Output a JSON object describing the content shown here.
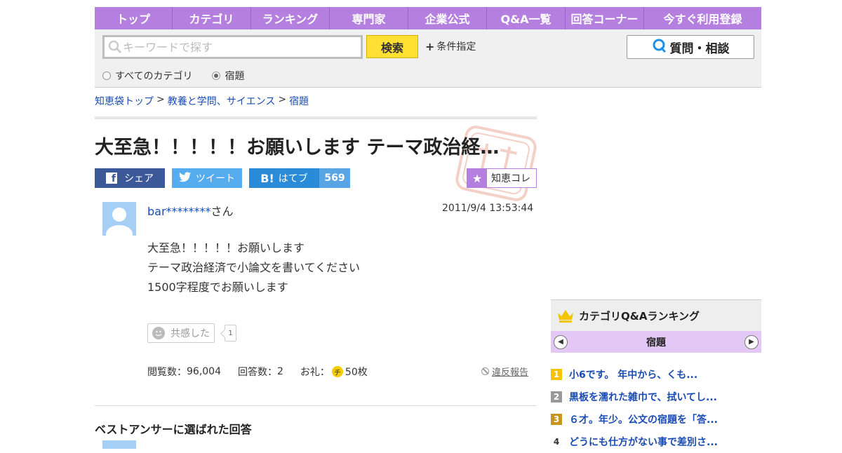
{
  "nav": {
    "items": [
      "トップ",
      "カテゴリ",
      "ランキング",
      "専門家",
      "企業公式",
      "Q&A一覧",
      "回答コーナー",
      "今すぐ利用登録"
    ]
  },
  "search": {
    "placeholder": "キーワードで探す",
    "button": "検索",
    "condition": "条件指定",
    "ask_button": "質問・相談",
    "radio_all": "すべてのカテゴリ",
    "radio_current": "宿題",
    "selected": "宿題"
  },
  "breadcrumb": {
    "items": [
      "知恵袋トップ",
      "教養と学問、サイエンス",
      "宿題"
    ],
    "separator": ">"
  },
  "question": {
    "title": "大至急！！！！！お願いします テーマ政治経…",
    "user": "bar********",
    "user_suffix": "さん",
    "date": "2011/9/4  13:53:44",
    "body": [
      "大至急！！！！！お願いします",
      "テーマ政治経済で小論文を書いてください",
      "1500字程度でお願いします"
    ],
    "empathy_label": "共感した",
    "empathy_count": "1",
    "views_label": "閲覧数：",
    "views": "96,004",
    "answers_label": "回答数：",
    "answers": "2",
    "reward_label": "お礼：",
    "reward_coin": "チ",
    "reward": "50枚",
    "report": "違反報告"
  },
  "share": {
    "facebook": "シェア",
    "twitter": "ツイート",
    "hatena_icon": "B!",
    "hatena": "はてブ",
    "hatena_count": "569",
    "chie_colle": "知恵コレ"
  },
  "best_answer": {
    "heading": "ベストアンサーに選ばれた回答"
  },
  "ranking": {
    "title": "カテゴリQ&Aランキング",
    "category": "宿題",
    "items": [
      {
        "no": "1",
        "text": "小6です。 年中から、くも...",
        "color": "#f5c400"
      },
      {
        "no": "2",
        "text": "黒板を濡れた雑巾で、拭いてし...",
        "color": "#999999"
      },
      {
        "no": "3",
        "text": "６才。年少。公文の宿題を「答...",
        "color": "#c8961e"
      },
      {
        "no": "4",
        "text": "どうにも仕方がない事で差別さ...",
        "color": ""
      }
    ]
  },
  "colors": {
    "accent": "#b57fe0",
    "link": "#1a4cb3",
    "search_button": "#ffe033"
  }
}
